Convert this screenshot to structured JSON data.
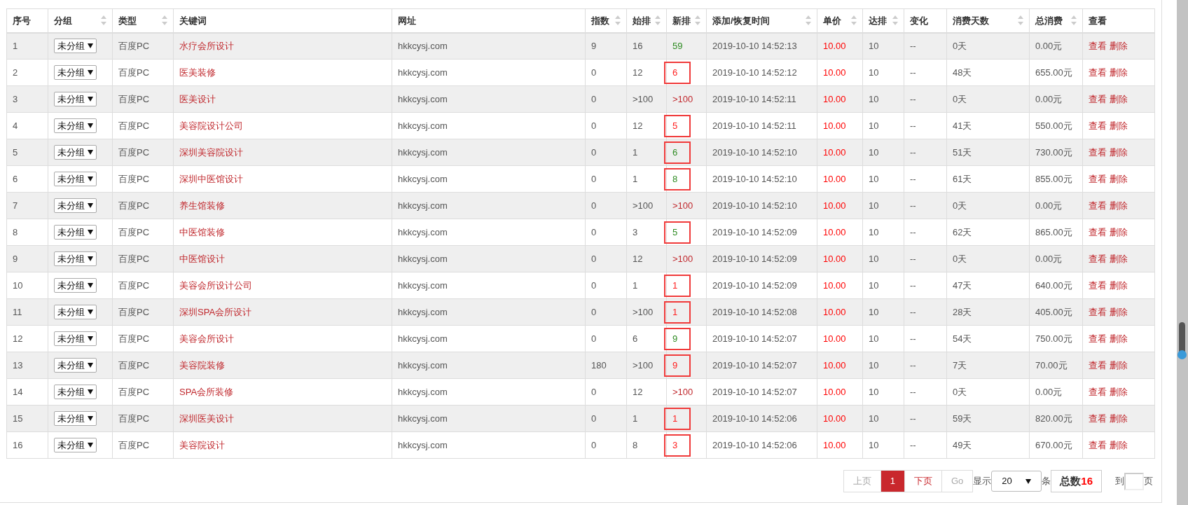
{
  "table": {
    "columns": [
      {
        "label": "序号",
        "sortable": false
      },
      {
        "label": "分组",
        "sortable": true
      },
      {
        "label": "类型",
        "sortable": true
      },
      {
        "label": "关键词",
        "sortable": false
      },
      {
        "label": "网址",
        "sortable": false
      },
      {
        "label": "指数",
        "sortable": true
      },
      {
        "label": "始排",
        "sortable": true
      },
      {
        "label": "新排",
        "sortable": true
      },
      {
        "label": "添加/恢复时间",
        "sortable": true
      },
      {
        "label": "单价",
        "sortable": true
      },
      {
        "label": "达排",
        "sortable": true
      },
      {
        "label": "变化",
        "sortable": false
      },
      {
        "label": "消费天数",
        "sortable": true
      },
      {
        "label": "总消费",
        "sortable": true
      },
      {
        "label": "查看",
        "sortable": false
      }
    ],
    "rows": [
      {
        "no": "1",
        "group": "未分组",
        "type": "百度PC",
        "keyword": "水疗会所设计",
        "url": "hkkcysj.com",
        "index": "9",
        "start_rank": "16",
        "new_rank": {
          "text": "59",
          "color": "#2e8b22",
          "annotated": false
        },
        "time": "2019-10-10 14:52:13",
        "price": "10.00",
        "target": "10",
        "change": "--",
        "days": "0天",
        "total": "0.00元",
        "actions": [
          "查看",
          "删除"
        ]
      },
      {
        "no": "2",
        "group": "未分组",
        "type": "百度PC",
        "keyword": "医美装修",
        "url": "hkkcysj.com",
        "index": "0",
        "start_rank": "12",
        "new_rank": {
          "text": "6",
          "color": "#ff2020",
          "annotated": true
        },
        "time": "2019-10-10 14:52:12",
        "price": "10.00",
        "target": "10",
        "change": "--",
        "days": "48天",
        "total": "655.00元",
        "actions": [
          "查看",
          "删除"
        ]
      },
      {
        "no": "3",
        "group": "未分组",
        "type": "百度PC",
        "keyword": "医美设计",
        "url": "hkkcysj.com",
        "index": "0",
        "start_rank": ">100",
        "new_rank": {
          "text": ">100",
          "color": "#c0282d",
          "annotated": false
        },
        "time": "2019-10-10 14:52:11",
        "price": "10.00",
        "target": "10",
        "change": "--",
        "days": "0天",
        "total": "0.00元",
        "actions": [
          "查看",
          "删除"
        ]
      },
      {
        "no": "4",
        "group": "未分组",
        "type": "百度PC",
        "keyword": "美容院设计公司",
        "url": "hkkcysj.com",
        "index": "0",
        "start_rank": "12",
        "new_rank": {
          "text": "5",
          "color": "#ff2020",
          "annotated": true
        },
        "time": "2019-10-10 14:52:11",
        "price": "10.00",
        "target": "10",
        "change": "--",
        "days": "41天",
        "total": "550.00元",
        "actions": [
          "查看",
          "删除"
        ]
      },
      {
        "no": "5",
        "group": "未分组",
        "type": "百度PC",
        "keyword": "深圳美容院设计",
        "url": "hkkcysj.com",
        "index": "0",
        "start_rank": "1",
        "new_rank": {
          "text": "6",
          "color": "#2e8b22",
          "annotated": true
        },
        "time": "2019-10-10 14:52:10",
        "price": "10.00",
        "target": "10",
        "change": "--",
        "days": "51天",
        "total": "730.00元",
        "actions": [
          "查看",
          "删除"
        ]
      },
      {
        "no": "6",
        "group": "未分组",
        "type": "百度PC",
        "keyword": "深圳中医馆设计",
        "url": "hkkcysj.com",
        "index": "0",
        "start_rank": "1",
        "new_rank": {
          "text": "8",
          "color": "#2e8b22",
          "annotated": true
        },
        "time": "2019-10-10 14:52:10",
        "price": "10.00",
        "target": "10",
        "change": "--",
        "days": "61天",
        "total": "855.00元",
        "actions": [
          "查看",
          "删除"
        ]
      },
      {
        "no": "7",
        "group": "未分组",
        "type": "百度PC",
        "keyword": "养生馆装修",
        "url": "hkkcysj.com",
        "index": "0",
        "start_rank": ">100",
        "new_rank": {
          "text": ">100",
          "color": "#c0282d",
          "annotated": false
        },
        "time": "2019-10-10 14:52:10",
        "price": "10.00",
        "target": "10",
        "change": "--",
        "days": "0天",
        "total": "0.00元",
        "actions": [
          "查看",
          "删除"
        ]
      },
      {
        "no": "8",
        "group": "未分组",
        "type": "百度PC",
        "keyword": "中医馆装修",
        "url": "hkkcysj.com",
        "index": "0",
        "start_rank": "3",
        "new_rank": {
          "text": "5",
          "color": "#2e8b22",
          "annotated": true
        },
        "time": "2019-10-10 14:52:09",
        "price": "10.00",
        "target": "10",
        "change": "--",
        "days": "62天",
        "total": "865.00元",
        "actions": [
          "查看",
          "删除"
        ]
      },
      {
        "no": "9",
        "group": "未分组",
        "type": "百度PC",
        "keyword": "中医馆设计",
        "url": "hkkcysj.com",
        "index": "0",
        "start_rank": "12",
        "new_rank": {
          "text": ">100",
          "color": "#c0282d",
          "annotated": false
        },
        "time": "2019-10-10 14:52:09",
        "price": "10.00",
        "target": "10",
        "change": "--",
        "days": "0天",
        "total": "0.00元",
        "actions": [
          "查看",
          "删除"
        ]
      },
      {
        "no": "10",
        "group": "未分组",
        "type": "百度PC",
        "keyword": "美容会所设计公司",
        "url": "hkkcysj.com",
        "index": "0",
        "start_rank": "1",
        "new_rank": {
          "text": "1",
          "color": "#ff2020",
          "annotated": true
        },
        "time": "2019-10-10 14:52:09",
        "price": "10.00",
        "target": "10",
        "change": "--",
        "days": "47天",
        "total": "640.00元",
        "actions": [
          "查看",
          "删除"
        ]
      },
      {
        "no": "11",
        "group": "未分组",
        "type": "百度PC",
        "keyword": "深圳SPA会所设计",
        "url": "hkkcysj.com",
        "index": "0",
        "start_rank": ">100",
        "new_rank": {
          "text": "1",
          "color": "#ff2020",
          "annotated": true
        },
        "time": "2019-10-10 14:52:08",
        "price": "10.00",
        "target": "10",
        "change": "--",
        "days": "28天",
        "total": "405.00元",
        "actions": [
          "查看",
          "删除"
        ]
      },
      {
        "no": "12",
        "group": "未分组",
        "type": "百度PC",
        "keyword": "美容会所设计",
        "url": "hkkcysj.com",
        "index": "0",
        "start_rank": "6",
        "new_rank": {
          "text": "9",
          "color": "#2e8b22",
          "annotated": true
        },
        "time": "2019-10-10 14:52:07",
        "price": "10.00",
        "target": "10",
        "change": "--",
        "days": "54天",
        "total": "750.00元",
        "actions": [
          "查看",
          "删除"
        ]
      },
      {
        "no": "13",
        "group": "未分组",
        "type": "百度PC",
        "keyword": "美容院装修",
        "url": "hkkcysj.com",
        "index": "180",
        "start_rank": ">100",
        "new_rank": {
          "text": "9",
          "color": "#ff2020",
          "annotated": true
        },
        "time": "2019-10-10 14:52:07",
        "price": "10.00",
        "target": "10",
        "change": "--",
        "days": "7天",
        "total": "70.00元",
        "actions": [
          "查看",
          "删除"
        ]
      },
      {
        "no": "14",
        "group": "未分组",
        "type": "百度PC",
        "keyword": "SPA会所装修",
        "url": "hkkcysj.com",
        "index": "0",
        "start_rank": "12",
        "new_rank": {
          "text": ">100",
          "color": "#c0282d",
          "annotated": false
        },
        "time": "2019-10-10 14:52:07",
        "price": "10.00",
        "target": "10",
        "change": "--",
        "days": "0天",
        "total": "0.00元",
        "actions": [
          "查看",
          "删除"
        ]
      },
      {
        "no": "15",
        "group": "未分组",
        "type": "百度PC",
        "keyword": "深圳医美设计",
        "url": "hkkcysj.com",
        "index": "0",
        "start_rank": "1",
        "new_rank": {
          "text": "1",
          "color": "#ff2020",
          "annotated": true
        },
        "time": "2019-10-10 14:52:06",
        "price": "10.00",
        "target": "10",
        "change": "--",
        "days": "59天",
        "total": "820.00元",
        "actions": [
          "查看",
          "删除"
        ]
      },
      {
        "no": "16",
        "group": "未分组",
        "type": "百度PC",
        "keyword": "美容院设计",
        "url": "hkkcysj.com",
        "index": "0",
        "start_rank": "8",
        "new_rank": {
          "text": "3",
          "color": "#ff2020",
          "annotated": true
        },
        "time": "2019-10-10 14:52:06",
        "price": "10.00",
        "target": "10",
        "change": "--",
        "days": "49天",
        "total": "670.00元",
        "actions": [
          "查看",
          "删除"
        ]
      }
    ]
  },
  "pagination": {
    "pages": [
      {
        "label": "上页",
        "disabled": true,
        "selected": false
      },
      {
        "label": "1",
        "disabled": false,
        "selected": true
      },
      {
        "label": "下页",
        "disabled": false,
        "selected": false
      },
      {
        "label": "Go",
        "disabled": true,
        "selected": false
      }
    ],
    "show_label": "显示",
    "page_size": "20",
    "unit_label": "条",
    "total_label": "总数",
    "total_count": "16",
    "goto_label": "到",
    "page_label": "页"
  }
}
